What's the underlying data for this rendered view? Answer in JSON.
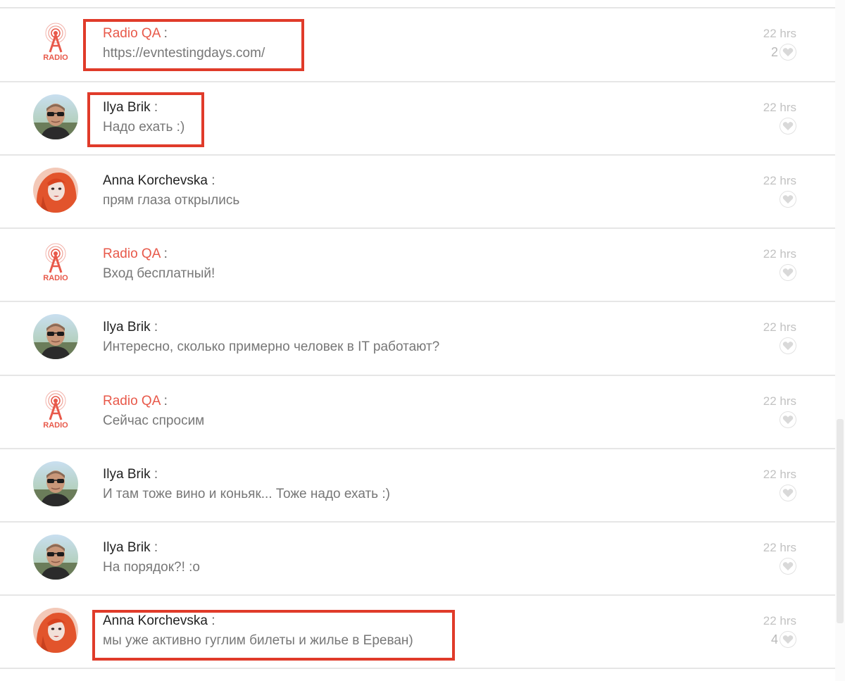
{
  "colors": {
    "brand": "#e8594a",
    "highlight": "#e03b2a",
    "message_text": "#777777",
    "timestamp": "#c2c2c2"
  },
  "messages": [
    {
      "author": "Radio QA",
      "separator": ":",
      "text": "https://evntestingdays.com/",
      "time": "22 hrs",
      "likes": "2",
      "avatar": "radio-logo",
      "brand": true,
      "highlighted": true
    },
    {
      "author": "Ilya Brik",
      "separator": ":",
      "text": "Надо ехать :)",
      "time": "22 hrs",
      "likes": "",
      "avatar": "ilya-photo",
      "brand": false,
      "highlighted": true
    },
    {
      "author": "Anna Korchevska",
      "separator": ":",
      "text": "прям глаза открылись",
      "time": "22 hrs",
      "likes": "",
      "avatar": "anna-photo",
      "brand": false,
      "highlighted": false
    },
    {
      "author": "Radio QA",
      "separator": ":",
      "text": "Вход бесплатный!",
      "time": "22 hrs",
      "likes": "",
      "avatar": "radio-logo",
      "brand": true,
      "highlighted": false
    },
    {
      "author": "Ilya Brik",
      "separator": ":",
      "text": "Интересно, сколько примерно человек в IT работают?",
      "time": "22 hrs",
      "likes": "",
      "avatar": "ilya-photo",
      "brand": false,
      "highlighted": false
    },
    {
      "author": "Radio QA",
      "separator": ":",
      "text": "Сейчас спросим",
      "time": "22 hrs",
      "likes": "",
      "avatar": "radio-logo",
      "brand": true,
      "highlighted": false
    },
    {
      "author": "Ilya Brik",
      "separator": ":",
      "text": "И там тоже вино и коньяк... Тоже надо ехать :)",
      "time": "22 hrs",
      "likes": "",
      "avatar": "ilya-photo",
      "brand": false,
      "highlighted": false
    },
    {
      "author": "Ilya Brik",
      "separator": ":",
      "text": "На порядок?! :о",
      "time": "22 hrs",
      "likes": "",
      "avatar": "ilya-photo",
      "brand": false,
      "highlighted": false
    },
    {
      "author": "Anna Korchevska",
      "separator": ":",
      "text": "мы уже активно гуглим билеты и жилье в Ереван)",
      "time": "22 hrs",
      "likes": "4",
      "avatar": "anna-photo",
      "brand": false,
      "highlighted": true
    }
  ],
  "radio_logo_text": "RADIO",
  "icons": {
    "like": "heart-icon",
    "avatar_logo": "radio-tower-icon"
  }
}
